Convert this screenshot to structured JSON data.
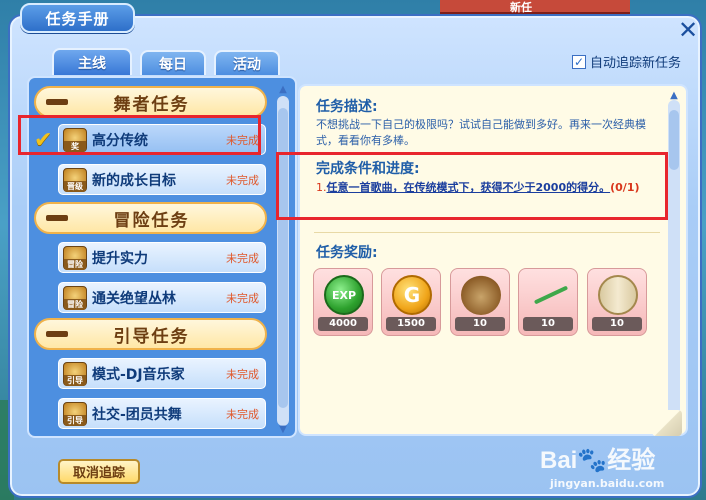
{
  "window": {
    "title": "任务手册",
    "close_label": "✕"
  },
  "background": {
    "top_banner": "新任"
  },
  "tabs": [
    {
      "label": "主线",
      "active": true
    },
    {
      "label": "每日",
      "active": false
    },
    {
      "label": "活动",
      "active": false
    }
  ],
  "auto_track": {
    "label": "自动追踪新任务",
    "checked": true,
    "check_glyph": "✓"
  },
  "categories": [
    {
      "title": "舞者任务",
      "quests": [
        {
          "name": "高分传统",
          "status": "未完成",
          "badge": "奖",
          "selected": true,
          "tracked": true
        },
        {
          "name": "新的成长目标",
          "status": "未完成",
          "badge": "晋级",
          "selected": false
        }
      ]
    },
    {
      "title": "冒险任务",
      "quests": [
        {
          "name": "提升实力",
          "status": "未完成",
          "badge": "冒险",
          "selected": false
        },
        {
          "name": "通关绝望丛林",
          "status": "未完成",
          "badge": "冒险",
          "selected": false
        }
      ]
    },
    {
      "title": "引导任务",
      "quests": [
        {
          "name": "模式-DJ音乐家",
          "status": "未完成",
          "badge": "引导",
          "selected": false
        },
        {
          "name": "社交-团员共舞",
          "status": "未完成",
          "badge": "引导",
          "selected": false
        }
      ]
    }
  ],
  "tracked_mark": "✔",
  "detail": {
    "desc_title": "任务描述:",
    "desc_text": "不想挑战一下自己的极限吗？试试自己能做到多好。再来一次经典模式，看看你有多棒。",
    "cond_title": "完成条件和进度:",
    "cond_index": "1.",
    "cond_text": "任意一首歌曲，在传统模式下，获得不少于2000的得分。",
    "cond_progress": "(0/1)",
    "rewards_title": "任务奖励:",
    "rewards": [
      {
        "icon": "exp-icon",
        "art_text": "EXP",
        "count": "4000"
      },
      {
        "icon": "gold-coin-icon",
        "art_text": "G",
        "count": "1500"
      },
      {
        "icon": "seed-pod-icon",
        "art_text": "",
        "count": "10"
      },
      {
        "icon": "needle-icon",
        "art_text": "",
        "count": "10"
      },
      {
        "icon": "thread-spool-icon",
        "art_text": "",
        "count": "10"
      }
    ]
  },
  "buttons": {
    "cancel_track": "取消追踪"
  },
  "watermark": {
    "logo": "Bai🐾经验",
    "url": "jingyan.baidu.com"
  },
  "colors": {
    "highlight_box": "#e8252d",
    "status_text": "#e0582b",
    "panel_blue": "#4d8fe0"
  }
}
